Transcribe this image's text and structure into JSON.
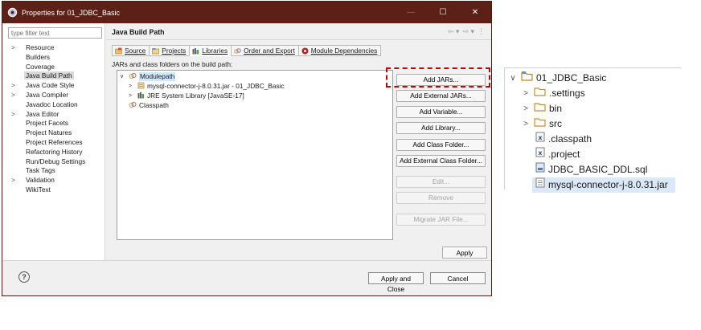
{
  "window": {
    "title": "Properties for 01_JDBC_Basic",
    "controls": {
      "minimize": "—",
      "maximize": "☐",
      "close": "✕"
    }
  },
  "nav": {
    "filter_placeholder": "type filter text",
    "items": [
      {
        "label": "Resource",
        "expandable": true
      },
      {
        "label": "Builders",
        "expandable": false
      },
      {
        "label": "Coverage",
        "expandable": false
      },
      {
        "label": "Java Build Path",
        "expandable": false,
        "selected": true
      },
      {
        "label": "Java Code Style",
        "expandable": true
      },
      {
        "label": "Java Compiler",
        "expandable": true
      },
      {
        "label": "Javadoc Location",
        "expandable": false
      },
      {
        "label": "Java Editor",
        "expandable": true
      },
      {
        "label": "Project Facets",
        "expandable": false
      },
      {
        "label": "Project Natures",
        "expandable": false
      },
      {
        "label": "Project References",
        "expandable": false
      },
      {
        "label": "Refactoring History",
        "expandable": false
      },
      {
        "label": "Run/Debug Settings",
        "expandable": false
      },
      {
        "label": "Task Tags",
        "expandable": false
      },
      {
        "label": "Validation",
        "expandable": true
      },
      {
        "label": "WikiText",
        "expandable": false
      }
    ]
  },
  "page": {
    "title": "Java Build Path",
    "tabs": [
      {
        "label": "Source",
        "icon": "source-folder-icon"
      },
      {
        "label": "Projects",
        "icon": "project-icon"
      },
      {
        "label": "Libraries",
        "icon": "library-icon",
        "active": true
      },
      {
        "label": "Order and Export",
        "icon": "order-icon"
      },
      {
        "label": "Module Dependencies",
        "icon": "module-icon"
      }
    ],
    "section_label": "JARs and class folders on the build path:",
    "tree": {
      "modulepath": "Modulepath",
      "jar": "mysql-connector-j-8.0.31.jar - 01_JDBC_Basic",
      "jre": "JRE System Library [JavaSE-17]",
      "classpath": "Classpath"
    },
    "buttons": {
      "add_jars": "Add JARs...",
      "add_external_jars": "Add External JARs...",
      "add_variable": "Add Variable...",
      "add_library": "Add Library...",
      "add_class_folder": "Add Class Folder...",
      "add_external_class_folder": "Add External Class Folder...",
      "edit": "Edit...",
      "remove": "Remove",
      "migrate": "Migrate JAR File..."
    },
    "apply": "Apply"
  },
  "footer": {
    "help": "?",
    "apply_and_close": "Apply and Close",
    "cancel": "Cancel"
  },
  "explorer": {
    "project": "01_JDBC_Basic",
    "items": [
      {
        "label": ".settings",
        "type": "folder"
      },
      {
        "label": "bin",
        "type": "folder"
      },
      {
        "label": "src",
        "type": "folder"
      },
      {
        "label": ".classpath",
        "type": "xml"
      },
      {
        "label": ".project",
        "type": "xml"
      },
      {
        "label": "JDBC_BASIC_DDL.sql",
        "type": "sql"
      },
      {
        "label": "mysql-connector-j-8.0.31.jar",
        "type": "jar",
        "selected": true
      }
    ]
  },
  "colors": {
    "titlebar": "#5b2117",
    "highlight": "#c00000",
    "selection": "#cde8ff"
  }
}
